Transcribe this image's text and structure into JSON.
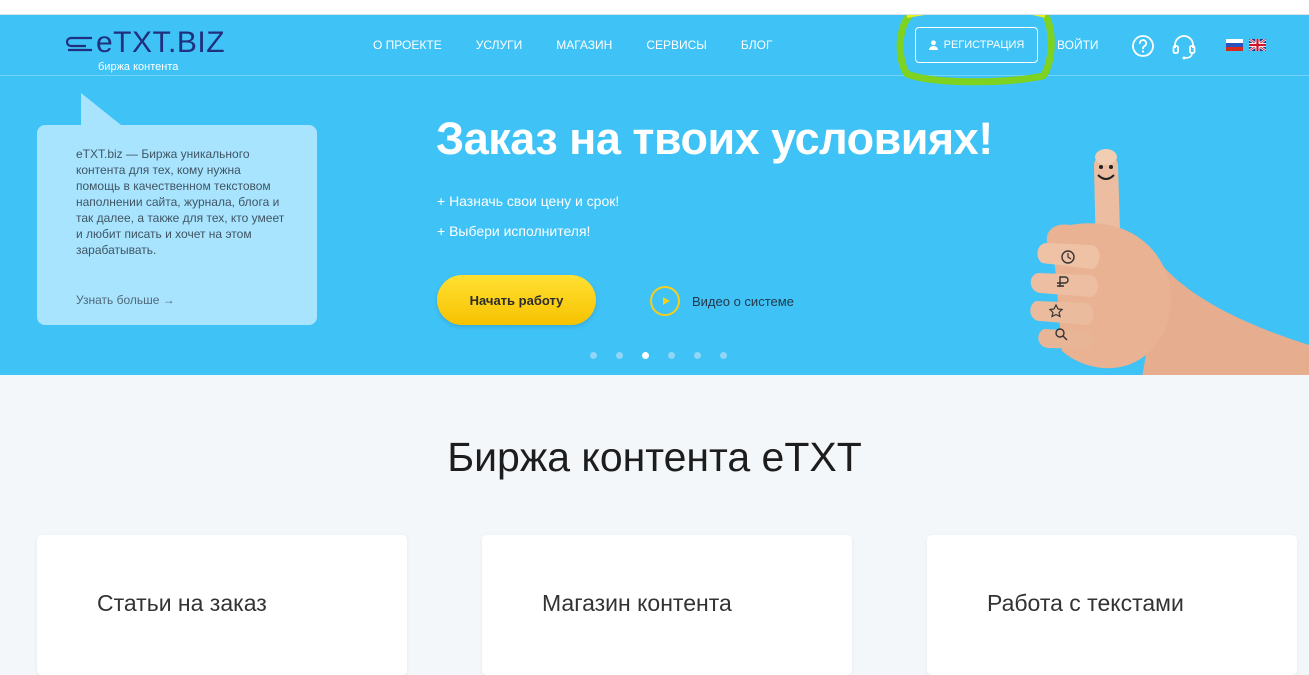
{
  "header": {
    "logo_text": "eTXT.BIZ",
    "logo_sub": "биржа контента",
    "nav": [
      "О ПРОЕКТЕ",
      "УСЛУГИ",
      "МАГАЗИН",
      "СЕРВИСЫ",
      "БЛОГ"
    ],
    "register_label": "РЕГИСТРАЦИЯ",
    "login_label": "ВОЙТИ",
    "languages": [
      "ru",
      "en"
    ]
  },
  "hero": {
    "bubble_text": "eTXT.biz — Биржа уникального контента для тех, кому нужна помощь в качественном текстовом наполнении сайта, журнала, блога и так далее, а также для тех, кто умеет и любит писать и хочет на этом зарабатывать.",
    "bubble_link": "Узнать больше →",
    "title": "Заказ на твоих условиях!",
    "bullets": [
      "+ Назначь свои цену и срок!",
      "+ Выбери исполнителя!"
    ],
    "start_button": "Начать работу",
    "video_label": "Видео о системе",
    "slide_count": 6,
    "active_slide": 3
  },
  "main": {
    "section_title": "Биржа контента eTXT",
    "cards": [
      "Статьи на заказ",
      "Магазин контента",
      "Работа с текстами"
    ]
  },
  "colors": {
    "hero_bg": "#3fc2f5",
    "logo": "#20307e",
    "button_yellow": "#f7c200",
    "highlight": "#7ed321"
  },
  "icons": [
    "user-icon",
    "help-icon",
    "headset-icon",
    "flag-ru-icon",
    "flag-en-icon",
    "play-icon",
    "thumbs-up-hand-image"
  ]
}
